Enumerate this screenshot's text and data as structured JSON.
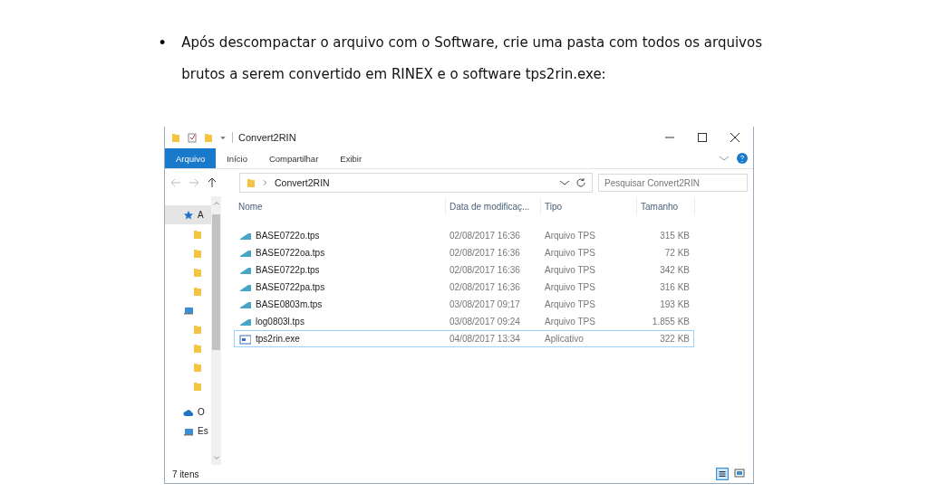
{
  "paragraph": {
    "bullet": "•",
    "text": "Após descompactar o arquivo com o Software, crie uma pasta com todos os arquivos brutos a serem convertido em RINEX e o software tps2rin.exe:"
  },
  "window": {
    "title": "Convert2RIN",
    "ribbon_tabs": [
      {
        "label": "Arquivo",
        "selected": true
      },
      {
        "label": "Início",
        "selected": false
      },
      {
        "label": "Compartilhar",
        "selected": false
      },
      {
        "label": "Exibir",
        "selected": false
      }
    ],
    "address": {
      "path": "Convert2RIN"
    },
    "search": {
      "placeholder": "Pesquisar Convert2RIN"
    },
    "sidebar": {
      "items": [
        {
          "kind": "star",
          "label": "A",
          "selected": true
        },
        {
          "kind": "folder",
          "selected": false
        },
        {
          "kind": "folder",
          "selected": false
        },
        {
          "kind": "folder",
          "selected": false
        },
        {
          "kind": "folder",
          "selected": false
        },
        {
          "kind": "pc",
          "selected": false
        },
        {
          "kind": "folder",
          "selected": false
        },
        {
          "kind": "folder",
          "selected": false
        },
        {
          "kind": "folder",
          "selected": false
        },
        {
          "kind": "folder",
          "selected": false
        },
        {
          "kind": "cloud",
          "label": "O",
          "selected": false
        },
        {
          "kind": "pc",
          "label": "Es",
          "selected": false
        }
      ]
    },
    "table": {
      "columns": [
        "Nome",
        "Data de modificaç...",
        "Tipo",
        "Tamanho"
      ],
      "rows": [
        {
          "kind": "tps",
          "name": "BASE0722o.tps",
          "date": "02/08/2017 16:36",
          "type": "Arquivo TPS",
          "size": "315 KB",
          "selected": false
        },
        {
          "kind": "tps",
          "name": "BASE0722oa.tps",
          "date": "02/08/2017 16:36",
          "type": "Arquivo TPS",
          "size": "72 KB",
          "selected": false
        },
        {
          "kind": "tps",
          "name": "BASE0722p.tps",
          "date": "02/08/2017 16:36",
          "type": "Arquivo TPS",
          "size": "342 KB",
          "selected": false
        },
        {
          "kind": "tps",
          "name": "BASE0722pa.tps",
          "date": "02/08/2017 16:36",
          "type": "Arquivo TPS",
          "size": "316 KB",
          "selected": false
        },
        {
          "kind": "tps",
          "name": "BASE0803m.tps",
          "date": "03/08/2017 09:17",
          "type": "Arquivo TPS",
          "size": "193 KB",
          "selected": false
        },
        {
          "kind": "tps",
          "name": "log0803l.tps",
          "date": "03/08/2017 09:24",
          "type": "Arquivo TPS",
          "size": "1.855 KB",
          "selected": false
        },
        {
          "kind": "exe",
          "name": "tps2rin.exe",
          "date": "04/08/2017 13:34",
          "type": "Aplicativo",
          "size": "322 KB",
          "selected": true
        }
      ]
    },
    "status_bar": {
      "count": "7 itens"
    }
  }
}
